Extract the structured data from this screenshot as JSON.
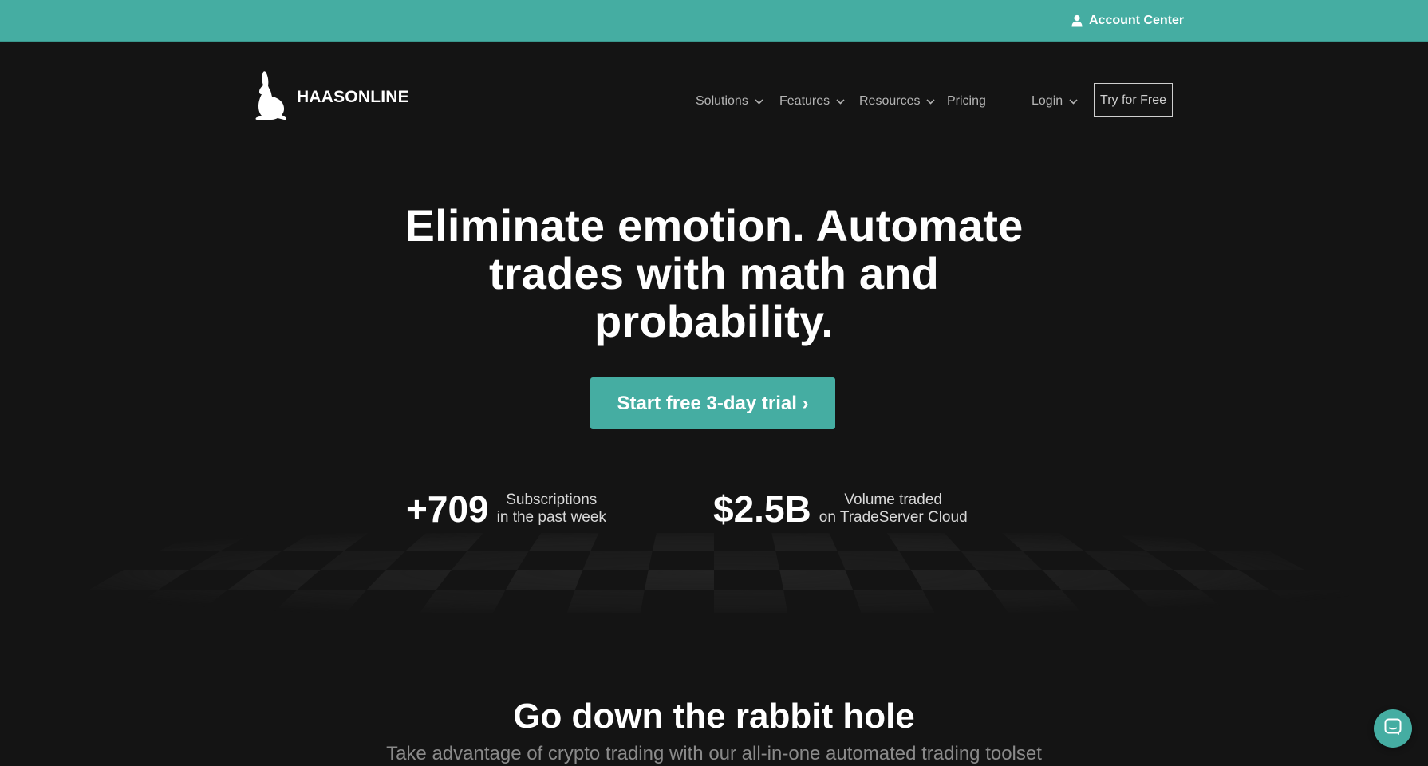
{
  "topbar": {
    "account_center_label": "Account Center",
    "account_icon": "user-icon",
    "background_color": "#45ada2"
  },
  "logo": {
    "icon": "rabbit-icon",
    "text": "HAASONLINE"
  },
  "nav": {
    "items": [
      {
        "label": "Solutions",
        "has_dropdown": true
      },
      {
        "label": "Features",
        "has_dropdown": true
      },
      {
        "label": "Resources",
        "has_dropdown": true
      },
      {
        "label": "Pricing",
        "has_dropdown": false
      }
    ],
    "login_label": "Login",
    "try_free_label": "Try for Free",
    "dropdown_icon": "chevron-down-icon"
  },
  "hero": {
    "title_line1": "Eliminate emotion. Automate",
    "title_line2": "trades with math and",
    "title_line3": "probability.",
    "cta_label": "Start free 3-day trial ›",
    "accent_color": "#45ada2"
  },
  "stats": [
    {
      "value": "+709",
      "label_line1": "Subscriptions",
      "label_line2": "in the past week"
    },
    {
      "value": "$2.5B",
      "label_line1": "Volume traded",
      "label_line2": "on TradeServer Cloud"
    }
  ],
  "section": {
    "title": "Go down the rabbit hole",
    "subtitle": "Take advantage of crypto trading with our all-in-one automated trading toolset"
  },
  "chat": {
    "icon": "chat-icon"
  }
}
